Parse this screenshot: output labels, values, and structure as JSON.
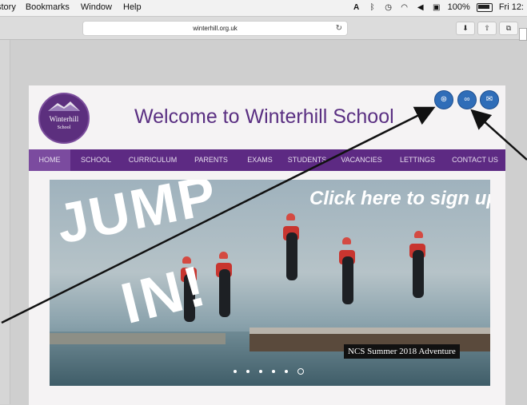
{
  "menubar": {
    "items": [
      "story",
      "Bookmarks",
      "Window",
      "Help"
    ],
    "battery": "100%",
    "clock": "Fri 12:"
  },
  "browser": {
    "url": "winterhill.org.uk"
  },
  "site": {
    "logo_text": "Winterhill",
    "logo_subtext": "School",
    "title": "Welcome to Winterhill School",
    "nav": [
      "HOME",
      "SCHOOL",
      "CURRICULUM",
      "PARENTS",
      "EXAMS",
      "STUDENTS",
      "VACANCIES",
      "LETTINGS",
      "CONTACT US"
    ],
    "active_nav": "HOME",
    "hero": {
      "jump_text": "JUMP",
      "in_text": "IN!",
      "signup_text": "Click here to sign up...",
      "caption": "NCS Summer 2018 Adventure",
      "slide_count": 6,
      "active_slide": 6
    }
  },
  "colors": {
    "brand_purple": "#5d2a83",
    "nav_active": "#7b4b9f",
    "title_purple": "#5a2f82",
    "social_blue": "#2f6db8"
  }
}
